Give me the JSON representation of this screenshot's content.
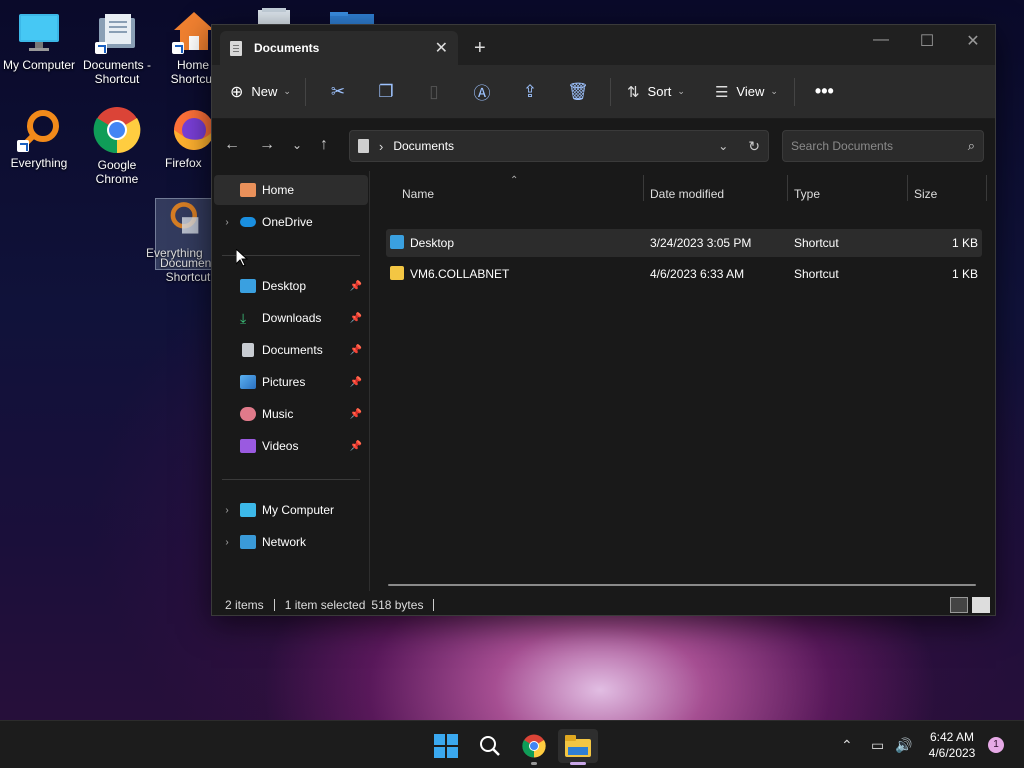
{
  "desktop": {
    "icons": [
      {
        "label": "My Computer"
      },
      {
        "label": "Documents - Shortcut"
      },
      {
        "label": "Home Shortcut"
      },
      {
        "label": "Everything"
      },
      {
        "label": "Google Chrome"
      },
      {
        "label": "Firefox"
      },
      {
        "label": "Everything"
      },
      {
        "label": "Documents Shortcut"
      }
    ]
  },
  "window": {
    "tab_title": "Documents",
    "toolbar": {
      "new_label": "New",
      "sort_label": "Sort",
      "view_label": "View"
    },
    "address": {
      "path": "Documents",
      "search_placeholder": "Search Documents"
    },
    "nav": {
      "items": [
        {
          "label": "Home"
        },
        {
          "label": "OneDrive"
        },
        {
          "label": "Desktop"
        },
        {
          "label": "Downloads"
        },
        {
          "label": "Documents"
        },
        {
          "label": "Pictures"
        },
        {
          "label": "Music"
        },
        {
          "label": "Videos"
        },
        {
          "label": "My Computer"
        },
        {
          "label": "Network"
        }
      ]
    },
    "columns": {
      "name": "Name",
      "date": "Date modified",
      "type": "Type",
      "size": "Size"
    },
    "files": [
      {
        "name": "Desktop",
        "date": "3/24/2023 3:05 PM",
        "type": "Shortcut",
        "size": "1 KB"
      },
      {
        "name": "VM6.COLLABNET",
        "date": "4/6/2023 6:33 AM",
        "type": "Shortcut",
        "size": "1 KB"
      }
    ],
    "status": {
      "items": "2 items",
      "selected": "1 item selected",
      "bytes": "518 bytes"
    }
  },
  "taskbar": {
    "time": "6:42 AM",
    "date": "4/6/2023",
    "notification_count": "1"
  }
}
